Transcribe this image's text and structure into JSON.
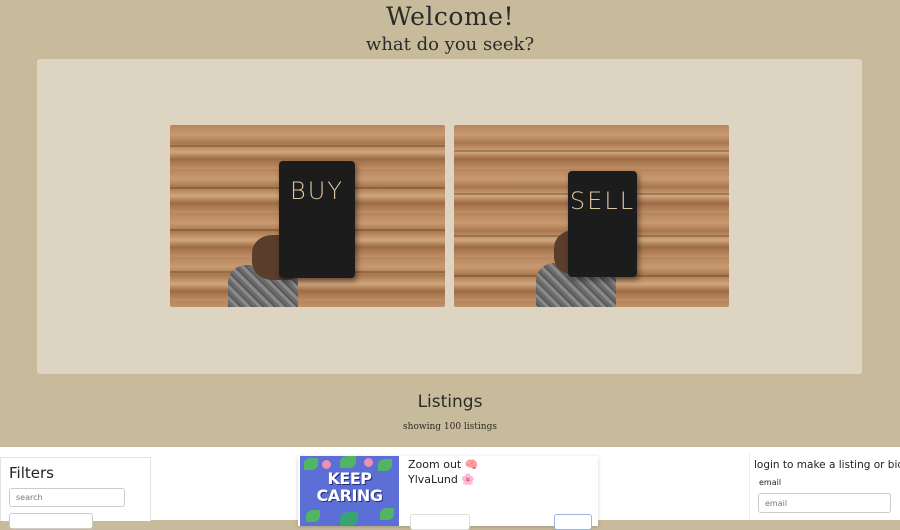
{
  "hero": {
    "title": "Welcome!",
    "subtitle": "what do you seek?"
  },
  "choices": [
    {
      "label": "BUY"
    },
    {
      "label": "SELL"
    }
  ],
  "listings": {
    "title": "Listings",
    "count_text": "showing 100 listings"
  },
  "filters": {
    "title": "Filters",
    "search_placeholder": "search"
  },
  "listing_card": {
    "thumb_text_line1": "KEEP",
    "thumb_text_line2": "CARING",
    "title": "Zoom out 🧠",
    "author": "YlvaLund 🌸"
  },
  "login": {
    "title": "login to make a listing or bid",
    "email_label": "email",
    "email_placeholder": "email"
  },
  "colors": {
    "background": "#c8bb9b",
    "panel": "#ddd5c2",
    "thumb_bg": "#5b6fd6"
  }
}
